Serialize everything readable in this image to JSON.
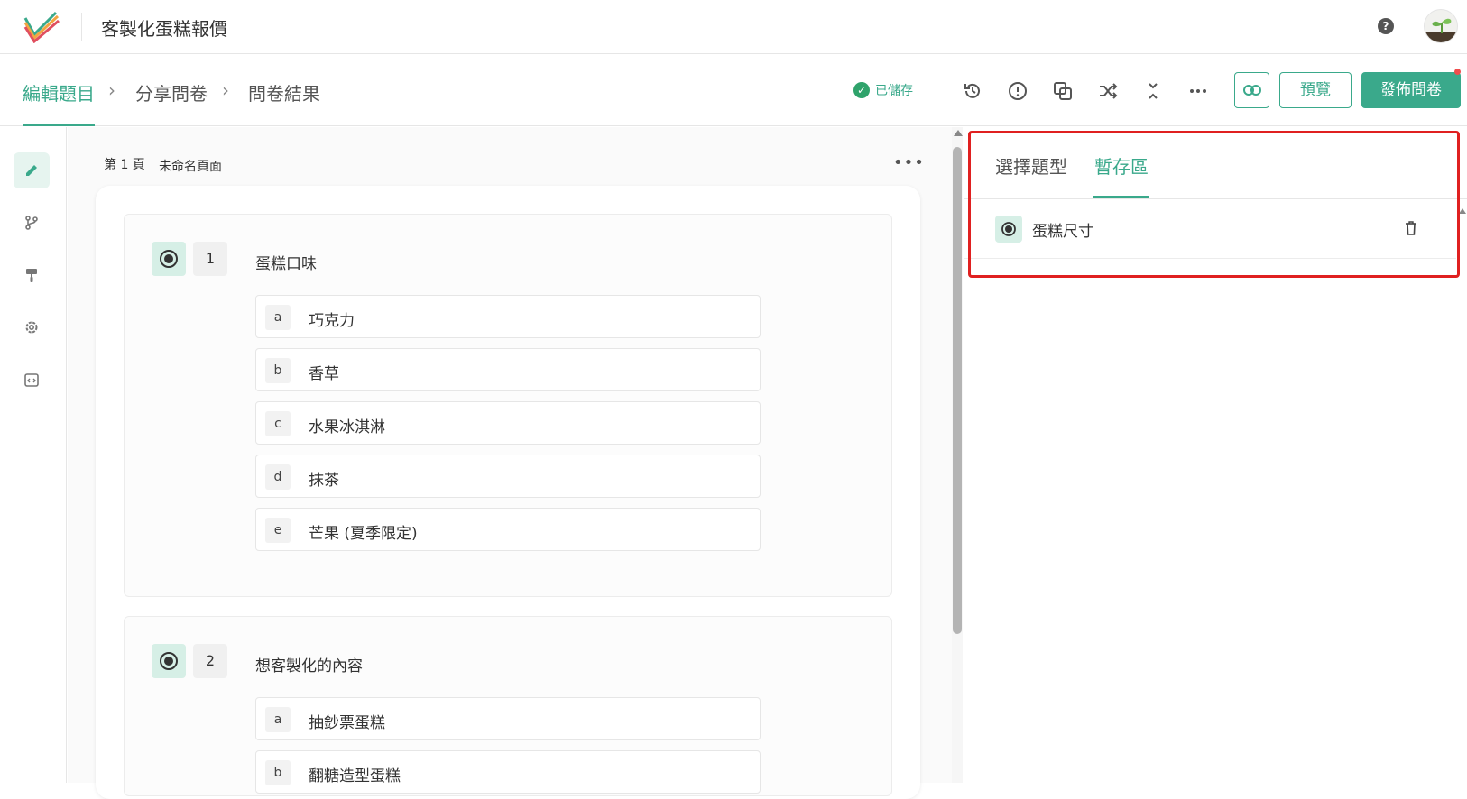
{
  "header": {
    "app_title": "客製化蛋糕報價",
    "help_icon": "help-icon",
    "avatar_icon": "sprout-avatar"
  },
  "nav": {
    "steps": [
      "編輯題目",
      "分享問卷",
      "問卷結果"
    ],
    "active_step": "編輯題目",
    "separator": "›",
    "saved_label": "已儲存",
    "toolbar_icons": [
      "history-icon",
      "alert-icon",
      "copy-icon",
      "shuffle-icon",
      "collapse-icon",
      "more-icon",
      "link-icon"
    ],
    "preview_label": "預覽",
    "publish_label": "發佈問卷"
  },
  "left_rail": {
    "items": [
      "edit-icon",
      "branch-icon",
      "paint-roller-icon",
      "gear-icon",
      "code-icon"
    ],
    "active": "edit-icon"
  },
  "page": {
    "label": "第 1 頁",
    "name": "未命名頁面",
    "more": "•••"
  },
  "questions": [
    {
      "number": "1",
      "title": "蛋糕口味",
      "type_icon": "radio-icon",
      "options": [
        {
          "letter": "a",
          "text": "巧克力"
        },
        {
          "letter": "b",
          "text": "香草"
        },
        {
          "letter": "c",
          "text": "水果冰淇淋"
        },
        {
          "letter": "d",
          "text": "抹茶"
        },
        {
          "letter": "e",
          "text": "芒果 (夏季限定)"
        }
      ]
    },
    {
      "number": "2",
      "title": "想客製化的內容",
      "type_icon": "radio-icon",
      "options": [
        {
          "letter": "a",
          "text": "抽鈔票蛋糕"
        },
        {
          "letter": "b",
          "text": "翻糖造型蛋糕"
        }
      ]
    }
  ],
  "right_panel": {
    "tabs": [
      "選擇題型",
      "暫存區"
    ],
    "active_tab": "暫存區",
    "stash_items": [
      {
        "label": "蛋糕尺寸",
        "icon": "radio-icon"
      }
    ]
  },
  "colors": {
    "accent": "#3aa98b",
    "highlight": "#e02020",
    "notify_dot": "#ef4d4d"
  }
}
